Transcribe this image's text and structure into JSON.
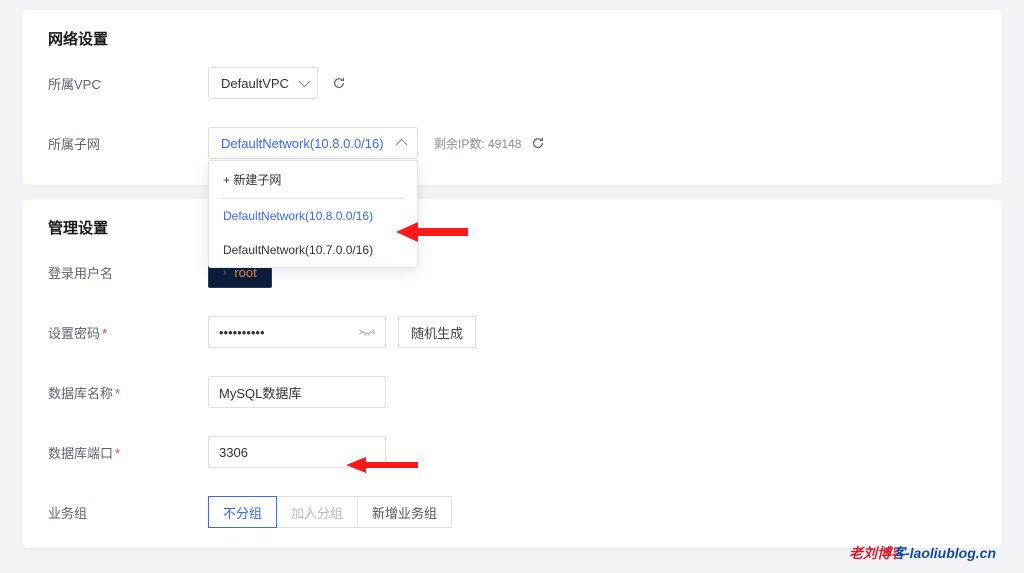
{
  "network": {
    "section_title": "网络设置",
    "vpc_label": "所属VPC",
    "vpc_value": "DefaultVPC",
    "subnet_label": "所属子网",
    "subnet_value": "DefaultNetwork(10.8.0.0/16)",
    "ip_count": "剩余IP数: 49148",
    "dropdown": {
      "new_label": "+ 新建子网",
      "options": [
        "DefaultNetwork(10.8.0.0/16)",
        "DefaultNetwork(10.7.0.0/16)"
      ]
    }
  },
  "management": {
    "section_title": "管理设置",
    "username_label": "登录用户名",
    "username_value": "root",
    "password_label": "设置密码",
    "password_value": "••••••••••",
    "password_random": "随机生成",
    "dbname_label": "数据库名称",
    "dbname_value": "MySQL数据库",
    "port_label": "数据库端口",
    "port_value": "3306",
    "group_label": "业务组",
    "group_options": {
      "none": "不分组",
      "join": "加入分组",
      "new": "新增业务组"
    }
  },
  "watermark": "老刘博客-laoliublog.cn"
}
